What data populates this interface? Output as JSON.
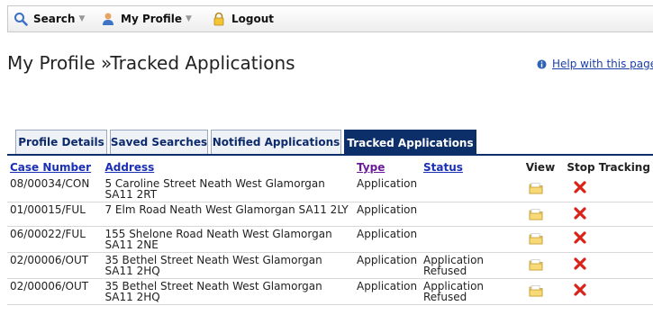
{
  "toolbar": {
    "search_label": "Search",
    "profile_label": "My Profile",
    "logout_label": "Logout"
  },
  "page": {
    "title": "My Profile »Tracked Applications",
    "help_link": "Help with this page"
  },
  "tabs": [
    {
      "label": "Profile Details",
      "active": false
    },
    {
      "label": "Saved Searches",
      "active": false
    },
    {
      "label": "Notified Applications",
      "active": false
    },
    {
      "label": "Tracked Applications",
      "active": true
    }
  ],
  "table": {
    "headers": {
      "case_number": "Case Number",
      "address": "Address",
      "type": "Type",
      "status": "Status",
      "view": "View",
      "stop": "Stop Tracking"
    },
    "rows": [
      {
        "case": "08/00034/CON",
        "address": "5 Caroline Street Neath West Glamorgan SA11 2RT",
        "type": "Application",
        "status": ""
      },
      {
        "case": "01/00015/FUL",
        "address": "7 Elm Road Neath West Glamorgan SA11 2LY",
        "type": "Application",
        "status": ""
      },
      {
        "case": "06/00022/FUL",
        "address": "155 Shelone Road Neath West Glamorgan SA11 2NE",
        "type": "Application",
        "status": ""
      },
      {
        "case": "02/00006/OUT",
        "address": "35 Bethel Street Neath West Glamorgan SA11 2HQ",
        "type": "Application",
        "status": "Application Refused"
      },
      {
        "case": "02/00006/OUT",
        "address": "35 Bethel Street Neath West Glamorgan SA11 2HQ",
        "type": "Application",
        "status": "Application Refused"
      }
    ]
  },
  "icons": {
    "search": "search-icon",
    "profile": "user-icon",
    "logout": "padlock-icon",
    "help": "info-icon",
    "view": "folder-icon",
    "stop": "red-x-icon"
  },
  "colors": {
    "active_tab": "#0c2f6a",
    "link": "#1b2fb5",
    "visited_link": "#6a1b9a",
    "stop_red": "#d9241b"
  }
}
